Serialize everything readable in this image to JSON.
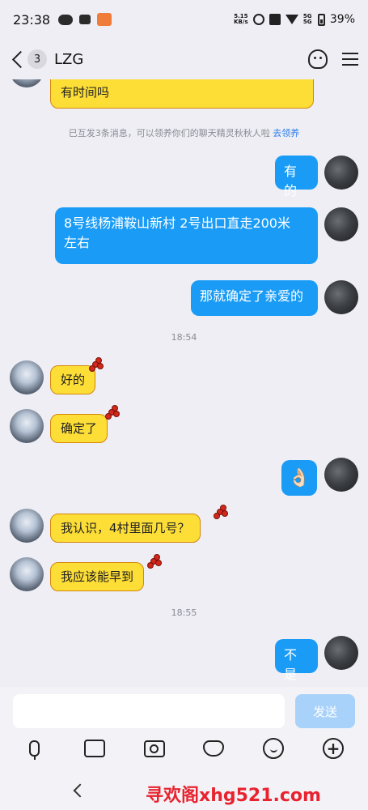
{
  "status_bar": {
    "time": "23:38",
    "net_speed_value": "5.15",
    "net_speed_unit": "KB/s",
    "signal_label_1": "5G",
    "signal_label_2": "5G",
    "battery": "39%"
  },
  "header": {
    "unread_count": "3",
    "title": "LZG"
  },
  "messages": {
    "partial_incoming": "有时间吗",
    "system_note": "已互发3条消息，可以领养你们的聊天精灵秋秋人啦",
    "system_link": "去领养",
    "out_1": "有的",
    "out_2_line1": "8号线杨浦鞍山新村  2号出口直走200米",
    "out_2_line2": "左右",
    "out_3": "那就确定了亲爱的",
    "time_1": "18:54",
    "in_1": "好的",
    "in_2": "确定了",
    "out_4_emoji": "👌🏻",
    "in_3": "我认识，4村里面几号？",
    "in_4": "我应该能早到",
    "time_2": "18:55",
    "out_5": "不是"
  },
  "input_bar": {
    "placeholder": "",
    "send_label": "发送"
  },
  "toolbar_icons": [
    "mic-icon",
    "image-icon",
    "camera-icon",
    "mask-icon",
    "smile-icon",
    "plus-icon"
  ],
  "watermark": "寻欢阁xhg521.com",
  "colors": {
    "outgoing_bubble": "#1a9cf6",
    "incoming_bubble": "#fdde37",
    "incoming_border": "#d4860a",
    "send_button": "#a9d2fa",
    "link": "#2a7be8",
    "watermark": "#e8232f"
  }
}
